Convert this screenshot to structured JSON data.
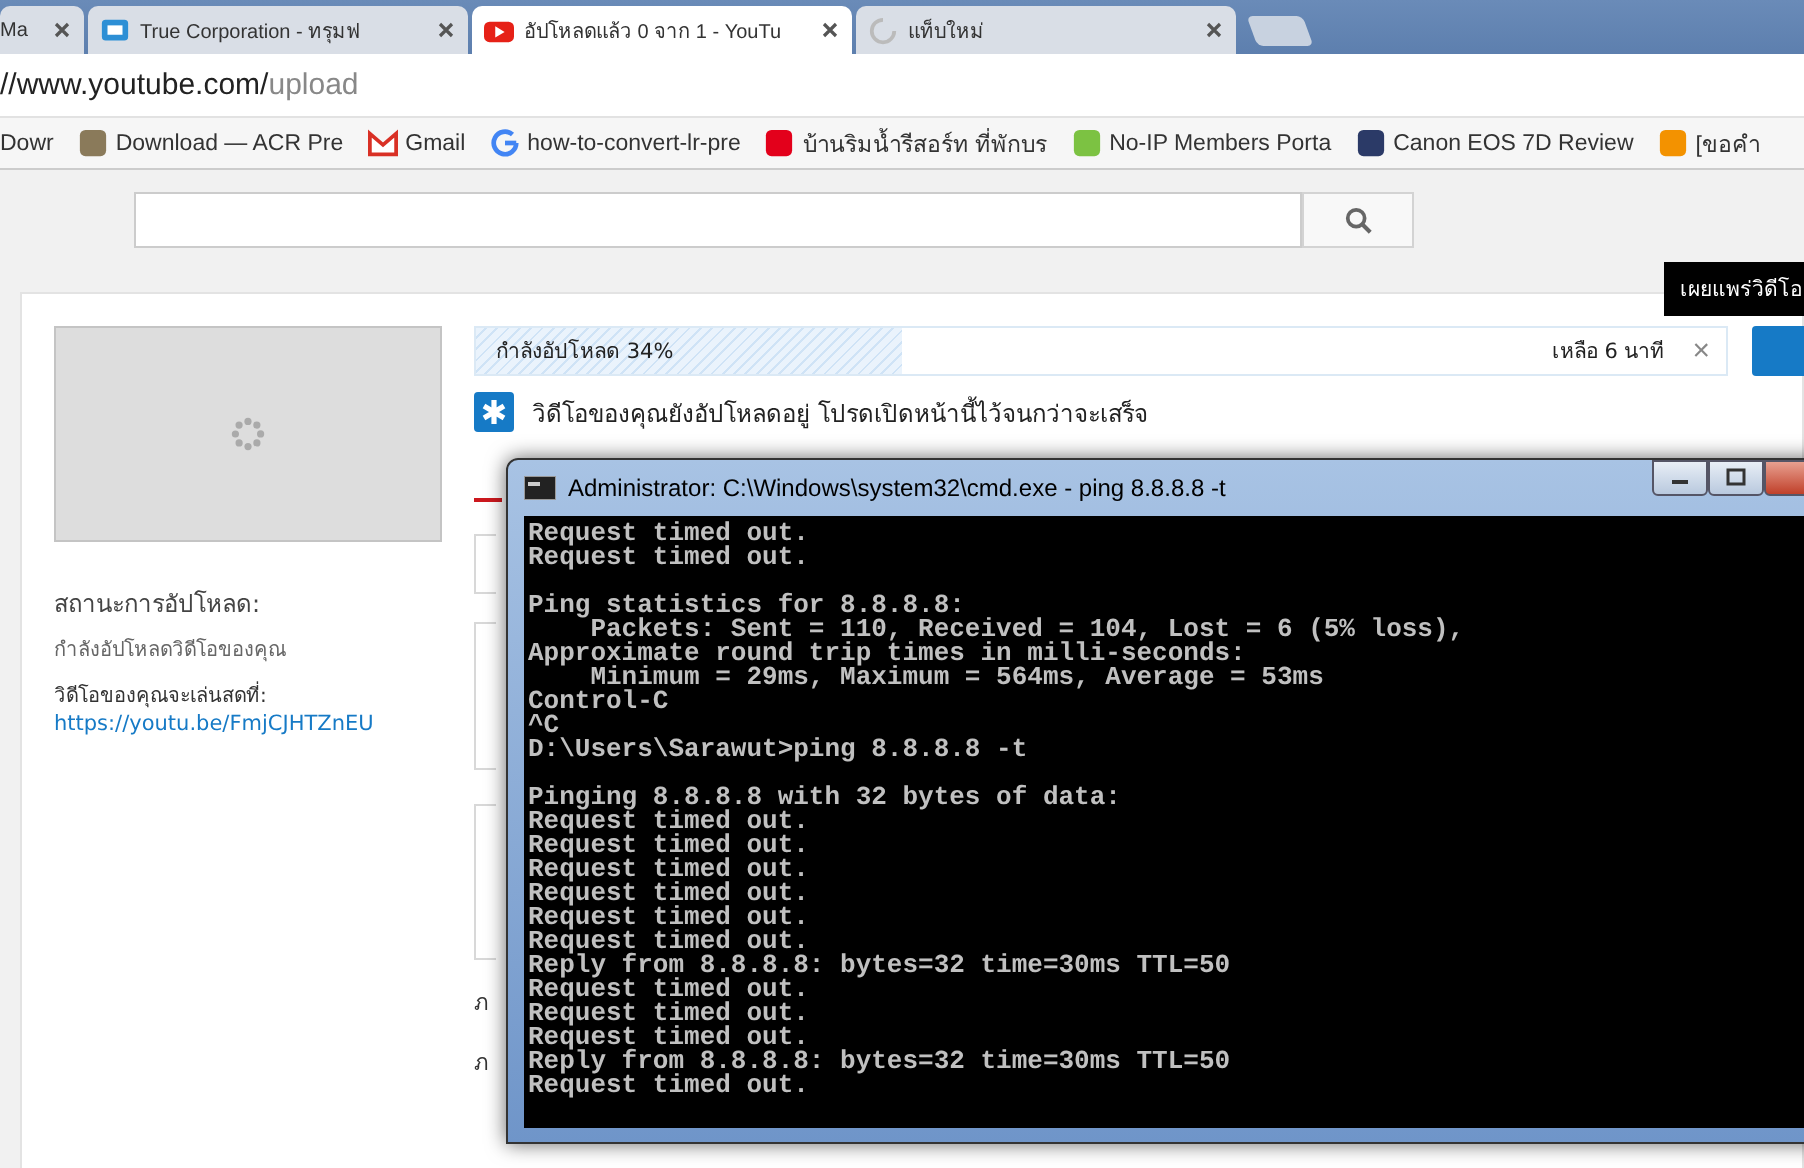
{
  "browser": {
    "tabs": [
      {
        "title": "Ma",
        "kind": "plain",
        "selected": false
      },
      {
        "title": "True Corporation - ทรุมฟ",
        "kind": "page",
        "selected": false
      },
      {
        "title": "อัปโหลดแล้ว 0 จาก 1 - YouTu",
        "kind": "video",
        "selected": true
      },
      {
        "title": "แท็บใหม่",
        "kind": "loading",
        "selected": false
      }
    ],
    "url_main": "//www.youtube.com/",
    "url_path": "upload",
    "bookmarks": [
      {
        "label": "Dowr",
        "kind": "plain"
      },
      {
        "label": "Download — ACR Pre",
        "kind": "brown"
      },
      {
        "label": "Gmail",
        "kind": "mail"
      },
      {
        "label": "how-to-convert-lr-pre",
        "kind": "letter"
      },
      {
        "label": "บ้านริมน้ำรีสอร์ท ที่พักบร",
        "kind": "red"
      },
      {
        "label": "No-IP Members Porta",
        "kind": "green"
      },
      {
        "label": "Canon EOS 7D Review",
        "kind": "navy"
      },
      {
        "label": "[ขอคำ",
        "kind": "orange"
      }
    ]
  },
  "tooltip": "เผยแพร่วิดีโอ",
  "upload": {
    "status_title": "สถานะการอัปโหลด:",
    "status_text": "กำลังอัปโหลดวิดีโอของคุณ",
    "live_label": "วิดีโอของคุณจะเล่นสดที่:",
    "live_link": "https://youtu.be/FmjCJHTZnEU",
    "progress_label": "กำลังอัปโหลด 34%",
    "level": 0.34,
    "remaining": "เหลือ 6 นาที",
    "close": "×",
    "notice": "วิดีโอของคุณยังอัปโหลดอยู่ โปรดเปิดหน้านี้ไว้จนกว่าจะเสร็จ",
    "field_labels": [
      "ภ",
      "ภ"
    ]
  },
  "console": {
    "title": "Administrator: C:\\Windows\\system32\\cmd.exe - ping  8.8.8.8 -t",
    "blocks": [
      [
        "Request timed out.",
        "Request timed out."
      ],
      [
        "Ping statistics for 8.8.8.8:",
        "    Packets: Sent = 110, Received = 104, Lost = 6 (5% loss),",
        "Approximate round trip times in milli-seconds:",
        "    Minimum = 29ms, Maximum = 564ms, Average = 53ms",
        "Control-C",
        "^C",
        "D:\\Users\\Sarawut>ping 8.8.8.8 -t"
      ],
      [
        "Pinging 8.8.8.8 with 32 bytes of data:",
        "Request timed out.",
        "Request timed out.",
        "Request timed out.",
        "Request timed out.",
        "Request timed out.",
        "Request timed out.",
        "Reply from 8.8.8.8: bytes=32 time=30ms TTL=50",
        "Request timed out.",
        "Request timed out.",
        "Request timed out.",
        "Reply from 8.8.8.8: bytes=32 time=30ms TTL=50",
        "Request timed out."
      ]
    ]
  }
}
